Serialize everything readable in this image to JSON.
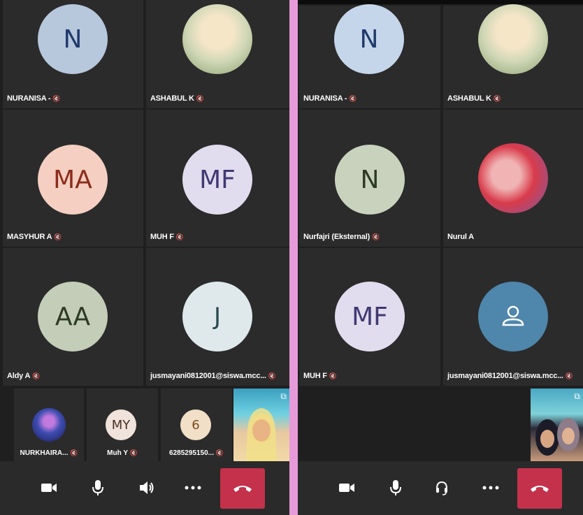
{
  "left": {
    "tiles": [
      {
        "name": "NURANISA -",
        "initials": "N",
        "avatar_bg": "#b7c7dc",
        "avatar_fg": "#1f3a6b",
        "muted": true
      },
      {
        "name": "ASHABUL K",
        "initials": "",
        "photo": "student-photo",
        "muted": true
      },
      {
        "name": "MASYHUR A",
        "initials": "MA",
        "avatar_bg": "#f4cfc2",
        "avatar_fg": "#8c2c1c",
        "muted": true
      },
      {
        "name": "MUH F",
        "initials": "MF",
        "avatar_bg": "#e2dcef",
        "avatar_fg": "#3f3a72",
        "muted": true
      },
      {
        "name": "Aldy A",
        "initials": "AA",
        "avatar_bg": "#c4cdb8",
        "avatar_fg": "#2d3a26",
        "muted": true
      },
      {
        "name": "jusmayani0812001@siswa.mcc...",
        "initials": "J",
        "avatar_bg": "#dfe9ec",
        "avatar_fg": "#2a4a50",
        "muted": true
      }
    ],
    "strip": [
      {
        "name": "NURKHAIRA...",
        "initials": "",
        "photo": "profile-photo",
        "muted": true
      },
      {
        "name": "Muh Y",
        "initials": "MY",
        "avatar_bg": "#efe3db",
        "avatar_fg": "#4a3024",
        "muted": true
      },
      {
        "name": "6285295150...",
        "initials": "6",
        "avatar_bg": "#f1dfc7",
        "avatar_fg": "#7a4c1a",
        "muted": true
      }
    ]
  },
  "right": {
    "tiles": [
      {
        "name": "NURANISA -",
        "initials": "N",
        "avatar_bg": "#c5d6ea",
        "avatar_fg": "#1f3a6b",
        "muted": true
      },
      {
        "name": "ASHABUL K",
        "initials": "",
        "photo": "student-photo",
        "muted": true
      },
      {
        "name": "Nurfajri (Eksternal)",
        "initials": "N",
        "avatar_bg": "#c9d2bd",
        "avatar_fg": "#2d3a26",
        "muted": true
      },
      {
        "name": "Nurul A",
        "initials": "",
        "photo": "profile-photo",
        "muted": false
      },
      {
        "name": "MUH F",
        "initials": "MF",
        "avatar_bg": "#e2dcef",
        "avatar_fg": "#3f3a72",
        "muted": true
      },
      {
        "name": "jusmayani0812001@siswa.mcc...",
        "initials": "",
        "avatar_bg": "#4f86ab",
        "avatar_fg": "#ffffff",
        "icon": "person-icon",
        "muted": true
      }
    ]
  },
  "colors": {
    "background": "#1f1f1f",
    "tile": "#2b2b2b",
    "hangup": "#c4314b",
    "divider": "#e79ad8"
  }
}
